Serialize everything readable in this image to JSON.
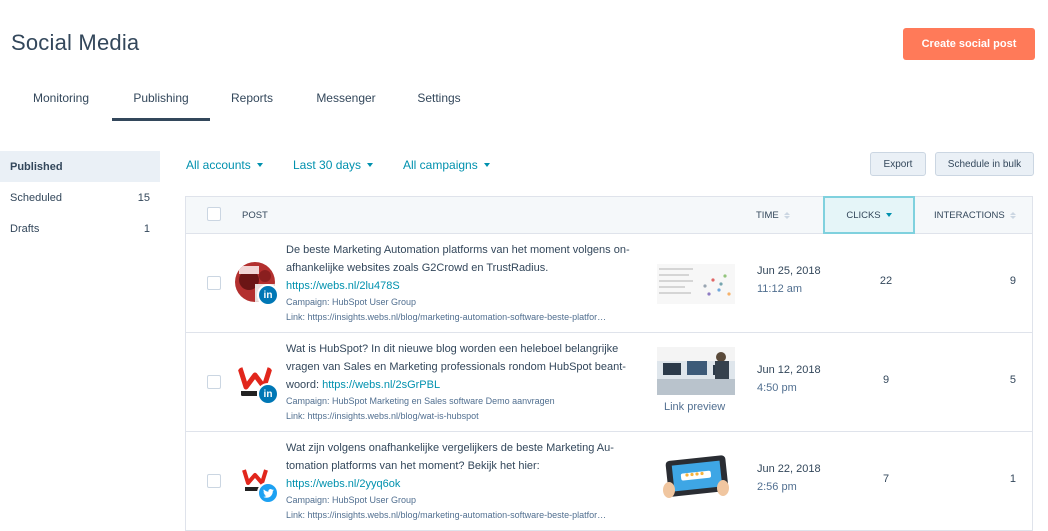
{
  "page": {
    "title": "Social Media"
  },
  "header": {
    "create_button": "Create social post"
  },
  "tabs": [
    {
      "label": "Monitoring"
    },
    {
      "label": "Publishing",
      "active": true
    },
    {
      "label": "Reports"
    },
    {
      "label": "Messenger"
    },
    {
      "label": "Settings"
    }
  ],
  "sidebar": {
    "items": [
      {
        "label": "Published",
        "count": "",
        "active": true
      },
      {
        "label": "Scheduled",
        "count": "15"
      },
      {
        "label": "Drafts",
        "count": "1"
      }
    ]
  },
  "filters": {
    "accounts": "All accounts",
    "date_range": "Last 30 days",
    "campaigns": "All campaigns"
  },
  "actions": {
    "export": "Export",
    "schedule_bulk": "Schedule in bulk"
  },
  "table": {
    "columns": {
      "post": "POST",
      "time": "TIME",
      "clicks": "CLICKS",
      "interactions": "INTERACTIONS"
    },
    "sorted_column": "clicks",
    "rows": [
      {
        "network": "linkedin",
        "avatar": "checkmate-avatar",
        "text": "De beste Marketing Automation platforms van het moment volgens on-afhankelijke websites zoals G2Crowd en TrustRadius. ",
        "link": "https://webs.nl/2lu478S",
        "campaign": "Campaign: HubSpot User Group",
        "link_meta": "Link: https://insights.webs.nl/blog/marketing-automation-software-beste-platfor…",
        "thumbnail": "chart-thumbnail",
        "thumbnail_caption": "",
        "date": "Jun 25, 2018",
        "time": "11:12 am",
        "clicks": "22",
        "interactions": "9"
      },
      {
        "network": "linkedin",
        "avatar": "webs-logo-avatar",
        "text": "Wat is HubSpot? In dit nieuwe blog worden een heleboel belangrijke vragen van Sales en Marketing professionals rondom HubSpot beant-woord: ",
        "link": "https://webs.nl/2sGrPBL",
        "campaign": "Campaign: HubSpot Marketing en Sales software Demo aanvragen",
        "link_meta": "Link: https://insights.webs.nl/blog/wat-is-hubspot",
        "thumbnail": "office-photo-thumbnail",
        "thumbnail_caption": "Link preview",
        "date": "Jun 12, 2018",
        "time": "4:50 pm",
        "clicks": "9",
        "interactions": "5"
      },
      {
        "network": "twitter",
        "avatar": "webs-logo-avatar",
        "text": "Wat zijn volgens onafhankelijke vergelijkers de beste Marketing Au-tomation platforms van het moment? Bekijk het hier: ",
        "link": "https://webs.nl/2yyq6ok",
        "campaign": "Campaign: HubSpot User Group",
        "link_meta": "Link: https://insights.webs.nl/blog/marketing-automation-software-beste-platfor…",
        "thumbnail": "tablet-rating-thumbnail",
        "thumbnail_caption": "",
        "date": "Jun 22, 2018",
        "time": "2:56 pm",
        "clicks": "7",
        "interactions": "1"
      }
    ]
  },
  "colors": {
    "accent": "#ff7a59",
    "link": "#0091ae",
    "text": "#33475b",
    "linkedin": "#0077b5",
    "twitter": "#1da1f2"
  }
}
